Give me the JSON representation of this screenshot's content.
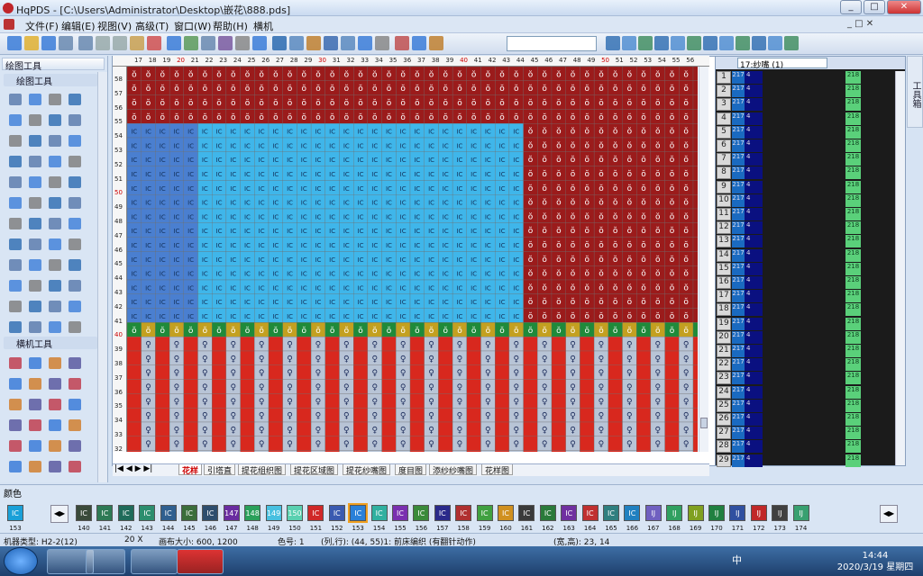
{
  "window": {
    "title": "HqPDS - [C:\\Users\\Administrator\\Desktop\\嵌花\\888.pds]",
    "min": "_",
    "max": "□",
    "close": "✕"
  },
  "menu": [
    "文件(F)",
    "编辑(E)",
    "视图(V)",
    "高级(T)",
    "窗口(W)",
    "帮助(H)",
    "横机"
  ],
  "panels": {
    "draw_tools": "绘图工具",
    "draw_group": "绘图工具",
    "machine_group": "横机工具"
  },
  "ruler": {
    "columns": [
      "17",
      "18",
      "19",
      "20",
      "21",
      "22",
      "23",
      "24",
      "25",
      "26",
      "27",
      "28",
      "29",
      "30",
      "31",
      "32",
      "33",
      "34",
      "35",
      "36",
      "37",
      "38",
      "39",
      "40",
      "41",
      "42",
      "43",
      "44",
      "45",
      "46",
      "47",
      "48",
      "49",
      "50",
      "51",
      "52",
      "53",
      "54",
      "55",
      "56"
    ],
    "rows": [
      "58",
      "57",
      "56",
      "55",
      "54",
      "53",
      "52",
      "51",
      "50",
      "49",
      "48",
      "47",
      "46",
      "45",
      "44",
      "43",
      "42",
      "41",
      "40",
      "39",
      "38",
      "37",
      "36",
      "35",
      "34",
      "33",
      "32"
    ]
  },
  "tabs": [
    "花样",
    "引塔直",
    "提花组织图",
    "提花区域图",
    "提花纱嘴图",
    "度目图",
    "添纱纱嘴图",
    "花样图"
  ],
  "right_panel": {
    "combo": "17:纱嘴 (1)",
    "rows": [
      "1",
      "2",
      "3",
      "4",
      "5",
      "6",
      "7",
      "8",
      "9",
      "10",
      "11",
      "12",
      "13",
      "14",
      "15",
      "16",
      "17",
      "18",
      "19",
      "20",
      "21",
      "22",
      "23",
      "24",
      "25",
      "26",
      "27",
      "28",
      "29"
    ],
    "col_a": "217",
    "col_b": "4",
    "col_c": "218"
  },
  "side_tab": "工具箱",
  "colors_title": "颜色",
  "swatches": [
    {
      "num": "153",
      "label": "IC"
    },
    {
      "num": "140",
      "label": "IC"
    },
    {
      "num": "141",
      "label": "IC"
    },
    {
      "num": "142",
      "label": "IC"
    },
    {
      "num": "143",
      "label": "IC"
    },
    {
      "num": "144",
      "label": "IC"
    },
    {
      "num": "145",
      "label": "IC"
    },
    {
      "num": "146",
      "label": "IC"
    },
    {
      "num": "147",
      "label": "147"
    },
    {
      "num": "148",
      "label": "148"
    },
    {
      "num": "149",
      "label": "149"
    },
    {
      "num": "150",
      "label": "150"
    },
    {
      "num": "151",
      "label": "IC"
    },
    {
      "num": "152",
      "label": "IC"
    },
    {
      "num": "153",
      "label": "IC"
    },
    {
      "num": "154",
      "label": "IC"
    },
    {
      "num": "155",
      "label": "IC"
    },
    {
      "num": "156",
      "label": "IC"
    },
    {
      "num": "157",
      "label": "IC"
    },
    {
      "num": "158",
      "label": "IC"
    },
    {
      "num": "159",
      "label": "IC"
    },
    {
      "num": "160",
      "label": "IC"
    },
    {
      "num": "161",
      "label": "IC"
    },
    {
      "num": "162",
      "label": "IC"
    },
    {
      "num": "163",
      "label": "IC"
    },
    {
      "num": "164",
      "label": "IC"
    },
    {
      "num": "165",
      "label": "IC"
    },
    {
      "num": "166",
      "label": "IC"
    },
    {
      "num": "167",
      "label": "IJ"
    },
    {
      "num": "168",
      "label": "IJ"
    },
    {
      "num": "169",
      "label": "IJ"
    },
    {
      "num": "170",
      "label": "IJ"
    },
    {
      "num": "171",
      "label": "IJ"
    },
    {
      "num": "172",
      "label": "IJ"
    },
    {
      "num": "173",
      "label": "IJ"
    },
    {
      "num": "174",
      "label": "IJ"
    }
  ],
  "swatch_colors": [
    "#1aa0d8",
    "#3a4a3a",
    "#2e7a55",
    "#1f6b5a",
    "#2c8e6e",
    "#2f5f8f",
    "#3b6e3b",
    "#2d4d6d",
    "#6a2ca0",
    "#2aa05a",
    "#48c0e0",
    "#5ad0b0",
    "#d02828",
    "#3a5ab0",
    "#2a80d8",
    "#30b0a0",
    "#7a30b0",
    "#3a8a3a",
    "#2a2a8a",
    "#b03030",
    "#40a040",
    "#d09020",
    "#3a3a3a",
    "#2a7a3a",
    "#7030a0",
    "#c03030",
    "#2f7f7f",
    "#2080c0",
    "#7060c0",
    "#30a060",
    "#80a020",
    "#208040",
    "#3050a0",
    "#c02828",
    "#404040",
    "#38a070"
  ],
  "status": {
    "machine": "机器类型: H2-2(12)",
    "zoom": "20 X",
    "canvas": "画布大小: 600, 1200",
    "color": "色号: 1",
    "pos": "(列,行): (44, 55)1: 前床编织 (有翻针动作)",
    "size": "(宽,高): 23, 14"
  },
  "clock": {
    "time": "14:44",
    "date": "2020/3/19 星期四"
  },
  "tray_text": "中"
}
